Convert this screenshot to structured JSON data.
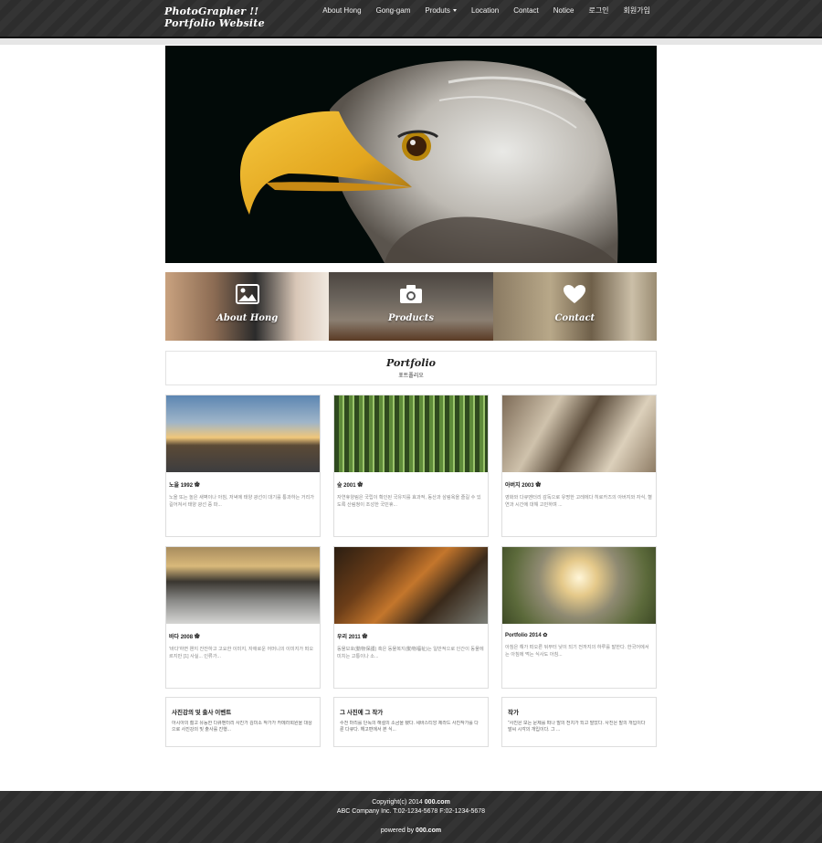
{
  "brand": {
    "line1": "PhotoGrapher !!",
    "line2": "Portfolio Website"
  },
  "nav": [
    {
      "label": "About Hong"
    },
    {
      "label": "Gong-gam"
    },
    {
      "label": "Produts"
    },
    {
      "label": "Location"
    },
    {
      "label": "Contact"
    },
    {
      "label": "Notice"
    },
    {
      "label": "로그인"
    },
    {
      "label": "회원가입"
    }
  ],
  "tiles": [
    {
      "label": "About Hong",
      "icon": "image-icon"
    },
    {
      "label": "Products",
      "icon": "camera-icon"
    },
    {
      "label": "Contact",
      "icon": "heart-icon"
    }
  ],
  "portfolio": {
    "title": "Portfolio",
    "subtitle": "포트폴리오"
  },
  "cards": [
    {
      "title": "노을 1992 ✿",
      "text": "노을 또는 놀은 새벽이나 아침, 저녁에 태양 광선이 대기를 통과하는 거리가 길어져서 태양 광선 중 파..."
    },
    {
      "title": "숲 2001 ✿",
      "text": "자연휴양림은 국립이 확인된 국유지를 효과적, 동산과 삼림욕을 즐길 수 있도록 산림청이 조성한 국민휴..."
    },
    {
      "title": "아버지 2003 ✿",
      "text": "영화와 다큐멘터리 감독으로 유명한 고레에다 히로카즈의 아버지와 자식, 혈연과 시간에 대해 고민하며 ..."
    },
    {
      "title": "바다 2008 ✿",
      "text": "'바다'하면 왠지 잔잔하고 고요한 이미지, 자애로운 어머니의 이미지가 떠오르지만 [1] 사실... 인류가..."
    },
    {
      "title": "우리 2011 ✿",
      "text": "동물보호(動物保護) 혹은 동물복지(動物福祉)는 일반적으로 인간이 동물에 미치는 고통이나 소..."
    },
    {
      "title": "Portfolio 2014 ✿",
      "text": "아침은 해가 떠오른 뒤부터 낮이 되기 전까지의 하루를 말한다. 한국어에서는 아침에 먹는 식사도 아침..."
    }
  ],
  "news": [
    {
      "title": "사진강의 및 출사 이벤트",
      "text": "아시아의 젊고 유능한 다큐멘터리 사진가 김미소 작가가 카메라회원을 대상으로 사진강의 및 출사를 진행..."
    },
    {
      "title": "그 사진에 그 작가",
      "text": "수천 마리를 단독의 해설의 소금을 됐다. 세바스티앙 제라드 사진작가를 다룬 다큐다. 해고편에서 본 식..."
    },
    {
      "title": "작가",
      "text": "\"사진은 보는 문제를 떠나 말의 전치가 되고 말았다. 사진은 말의 개입이다 말씨 시각의 개입이다. 그 ..."
    }
  ],
  "footer": {
    "copyright_prefix": "Copyright(c) 2014 ",
    "copyright_site": "000.com",
    "company": "ABC Company Inc. T:02-1234-5678 F:02-1234-5678",
    "powered_prefix": "powered by ",
    "powered_site": "000.com"
  }
}
